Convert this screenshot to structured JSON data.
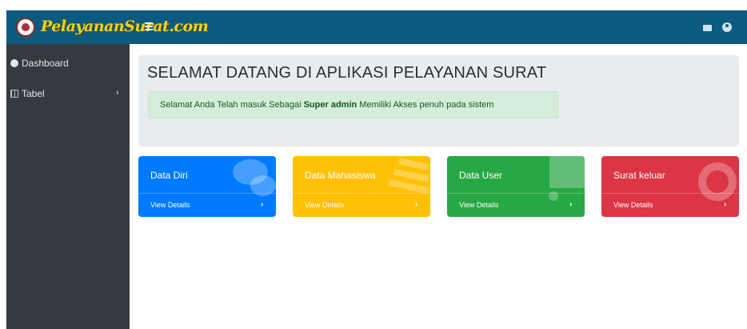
{
  "header": {
    "brand": "PelayananSurat.com",
    "menu_icon": "hamburger-icon",
    "right_icons": [
      "envelope-icon",
      "user-circle-icon"
    ],
    "color": "#0c5a7f"
  },
  "sidebar": {
    "items": [
      {
        "label": "Dashboard",
        "icon": "dashboard-icon"
      },
      {
        "label": "Tabel",
        "icon": "table-icon",
        "chevron": "›"
      }
    ]
  },
  "main": {
    "title": "SELAMAT DATANG DI APLIKASI PELAYANAN SURAT",
    "alert": {
      "prefix": "Selamat Anda Telah masuk Sebagai ",
      "role": "Super admin",
      "suffix": " Memiliki Akses penuh pada sistem"
    },
    "cards": [
      {
        "title": "Data Diri",
        "link": "View Details",
        "arrow": "›",
        "color": "#007bff",
        "icon": "comments-icon"
      },
      {
        "title": "Data Mahasiswa",
        "link": "View Details",
        "arrow": "›",
        "color": "#ffc107",
        "icon": "list-icon"
      },
      {
        "title": "Data User",
        "link": "View Details",
        "arrow": "›",
        "color": "#28a745",
        "icon": "shopping-cart-icon"
      },
      {
        "title": "Surat keluar",
        "link": "View Details",
        "arrow": "›",
        "color": "#dc3545",
        "icon": "life-ring-icon"
      }
    ]
  }
}
